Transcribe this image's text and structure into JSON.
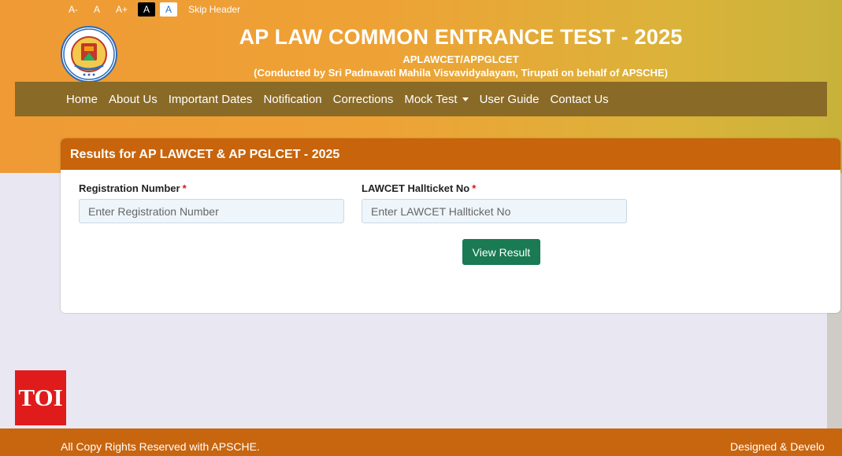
{
  "accessibility": {
    "font_decrease": "A-",
    "font_normal": "A",
    "font_increase": "A+",
    "theme_dark": "A",
    "theme_light": "A",
    "skip_header": "Skip Header"
  },
  "header": {
    "title": "AP LAW COMMON ENTRANCE TEST - 2025",
    "subtitle": "APLAWCET/APPGLCET",
    "conducted_by": "(Conducted by Sri Padmavati Mahila Visvavidyalayam, Tirupati on behalf of APSCHE)"
  },
  "nav": {
    "items": [
      {
        "label": "Home"
      },
      {
        "label": "About Us"
      },
      {
        "label": "Important Dates"
      },
      {
        "label": "Notification"
      },
      {
        "label": "Corrections"
      },
      {
        "label": "Mock Test"
      },
      {
        "label": "User Guide"
      },
      {
        "label": "Contact Us"
      }
    ]
  },
  "card": {
    "title": "Results for AP LAWCET & AP PGLCET - 2025",
    "registration_label": "Registration Number",
    "registration_placeholder": "Enter Registration Number",
    "hallticket_label": "LAWCET Hallticket No",
    "hallticket_placeholder": "Enter LAWCET Hallticket No",
    "required_mark": "*",
    "submit_label": "View Result"
  },
  "watermark": {
    "text": "TOI"
  },
  "footer": {
    "left": "All Copy Rights Reserved with APSCHE.",
    "right": "Designed & Develo"
  },
  "colors": {
    "header_gradient_start": "#ef9a35",
    "header_gradient_end": "#c9b33b",
    "nav_bg": "#8a6a27",
    "card_header_bg": "#c7640c",
    "submit_bg": "#197a53",
    "footer_bg": "#c8650f",
    "toi_bg": "#e01b1b"
  }
}
